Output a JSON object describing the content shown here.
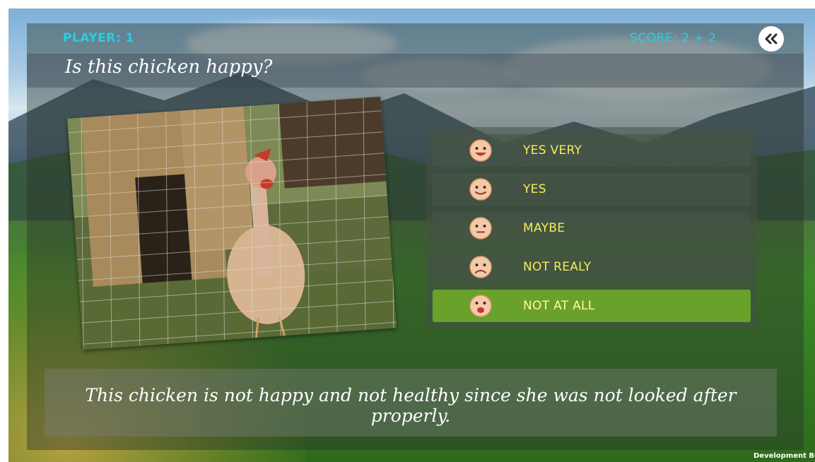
{
  "header": {
    "player_label": "PLAYER: 1",
    "score_label": "SCORE: 2 + 2"
  },
  "question": {
    "text": "Is this chicken happy?"
  },
  "answers": [
    {
      "label": "YES VERY",
      "icon": "laughing-face-icon",
      "selected": false
    },
    {
      "label": "YES",
      "icon": "smiling-face-icon",
      "selected": false
    },
    {
      "label": "MAYBE",
      "icon": "neutral-face-icon",
      "selected": false
    },
    {
      "label": "NOT REALY",
      "icon": "sad-face-icon",
      "selected": false
    },
    {
      "label": "NOT AT ALL",
      "icon": "shocked-face-icon",
      "selected": true
    }
  ],
  "feedback": {
    "text": "This chicken is not happy and not healthy since she was not looked after properly."
  },
  "footer": {
    "build_label": "Development Build"
  },
  "colors": {
    "accent_cyan": "#27d0e0",
    "answer_text": "#f3ee58",
    "selected_answer": "#6aa12a"
  }
}
